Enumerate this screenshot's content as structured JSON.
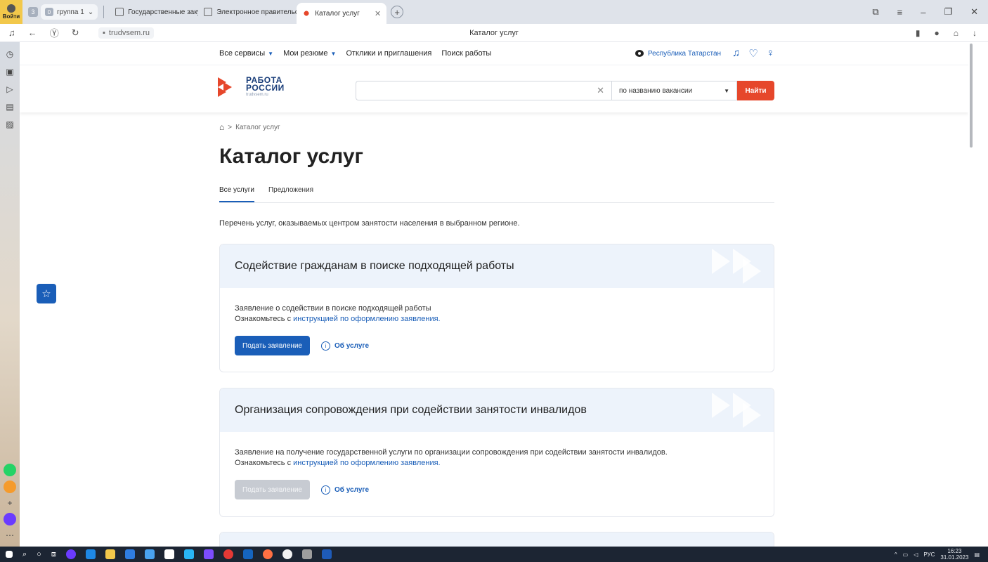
{
  "browser": {
    "login_label": "Войти",
    "tab_count": "3",
    "group_count": "0",
    "group_label": "группа 1",
    "tabs": [
      {
        "title": "Государственные закупки"
      },
      {
        "title": "Электронное правительство"
      },
      {
        "title": "Каталог услуг"
      }
    ],
    "url": "trudvsem.ru",
    "page_title": "Каталог услуг"
  },
  "site": {
    "nav": {
      "all_services": "Все сервисы",
      "my_resumes": "Мои резюме",
      "responses": "Отклики и приглашения",
      "job_search": "Поиск работы",
      "region": "Республика Татарстан"
    },
    "logo": {
      "line1": "РАБОТА",
      "line2": "РОССИИ",
      "line3": "trudvsem.ru"
    },
    "search": {
      "placeholder": "",
      "mode": "по названию вакансии",
      "button": "Найти"
    },
    "breadcrumb": {
      "current": "Каталог услуг"
    },
    "title": "Каталог услуг",
    "tabs": [
      {
        "label": "Все услуги"
      },
      {
        "label": "Предложения"
      }
    ],
    "intro": "Перечень услуг, оказываемых центром занятости населения в выбранном регионе.",
    "cards": [
      {
        "title": "Содействие гражданам в поиске подходящей работы",
        "desc": "Заявление о содействии в поиске подходящей работы",
        "hint_prefix": "Ознакомьтесь с ",
        "hint_link": "инструкцией по оформлению заявления.",
        "apply": "Подать заявление",
        "about": "Об услуге"
      },
      {
        "title": "Организация сопровождения при содействии занятости инвалидов",
        "desc": "Заявление на получение государственной услуги по организации сопровождения при содействии занятости инвалидов.",
        "hint_prefix": "Ознакомьтесь с ",
        "hint_link": "инструкцией по оформлению заявления.",
        "apply": "Подать заявление",
        "about": "Об услуге"
      }
    ]
  },
  "taskbar": {
    "lang": "РУС",
    "time": "16:23",
    "date": "31.01.2023"
  },
  "colors": {
    "accent": "#1a5eb8",
    "brand_red": "#e6472b",
    "card_head": "#edf3fb"
  }
}
